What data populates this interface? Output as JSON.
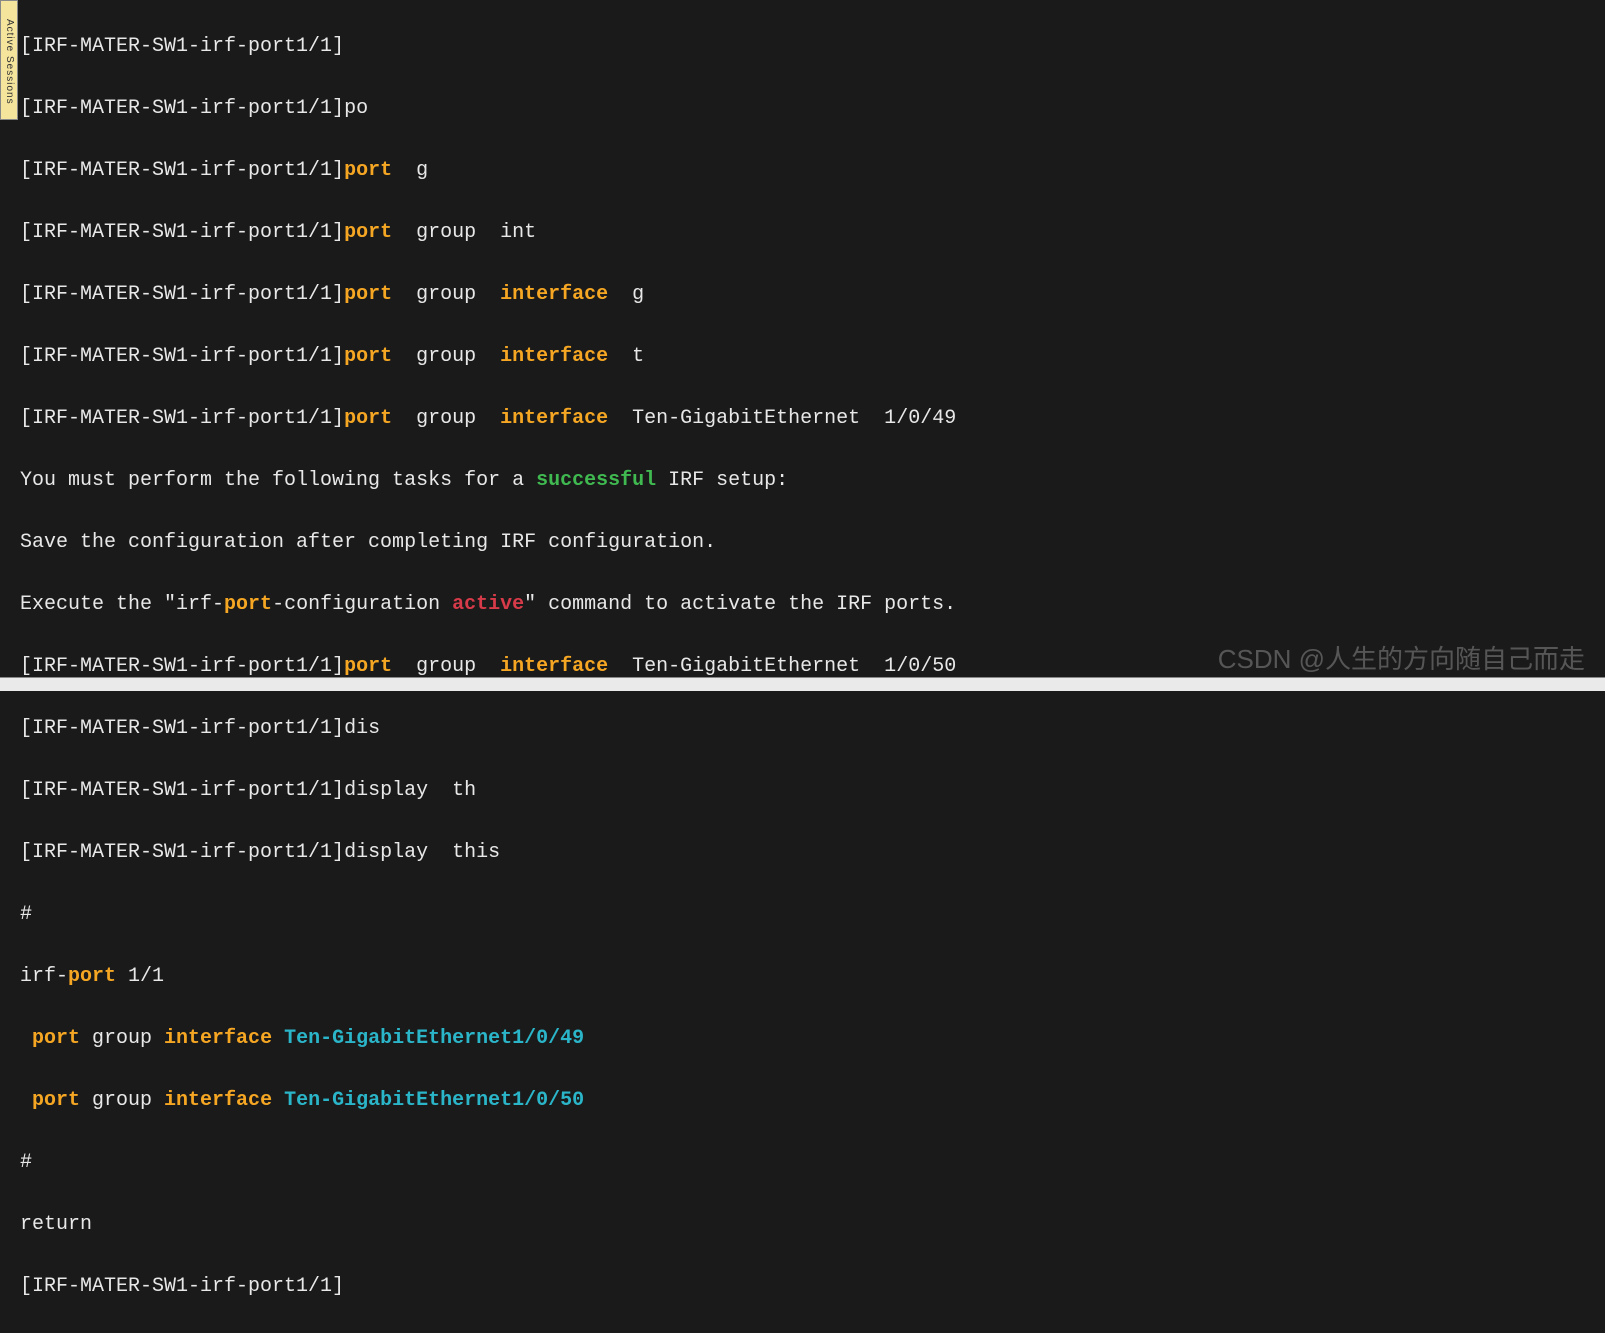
{
  "sidebar": {
    "label": "Active Sessions"
  },
  "prompt": "[IRF-MATER-SW1-irf-port1/1]",
  "kw": {
    "port": "port",
    "interface": "interface",
    "successful": "successful",
    "active": "active"
  },
  "lines": {
    "l1_rest": "",
    "l2_rest": "po",
    "l3_rest": "  g",
    "l4_rest": "  group  int",
    "l5_rest": "  group  ",
    "l5_tail": "  g",
    "l6_tail": "  t",
    "l7_tail": "  Ten-GigabitEthernet  1/0/49",
    "l8a": "You must perform the following tasks for a ",
    "l8b": " IRF setup:",
    "l9": "Save the configuration after completing IRF configuration.",
    "l10a": "Execute the \"irf-",
    "l10b": "-configuration ",
    "l10c": "\" command to activate the IRF ports.",
    "l11_tail": "  Ten-GigabitEthernet  1/0/50",
    "l12_rest": "dis",
    "l13_rest": "display  th",
    "l14_rest": "display  this",
    "hash": "#",
    "l16a": "irf-",
    "l16b": " 1/1",
    "l17_pre": " ",
    "l17_mid": " group ",
    "l17_iface": "Ten-GigabitEthernet1/0/49",
    "l18_iface": "Ten-GigabitEthernet1/0/50",
    "l20": "return"
  },
  "watermark": "CSDN @人生的方向随自己而走"
}
